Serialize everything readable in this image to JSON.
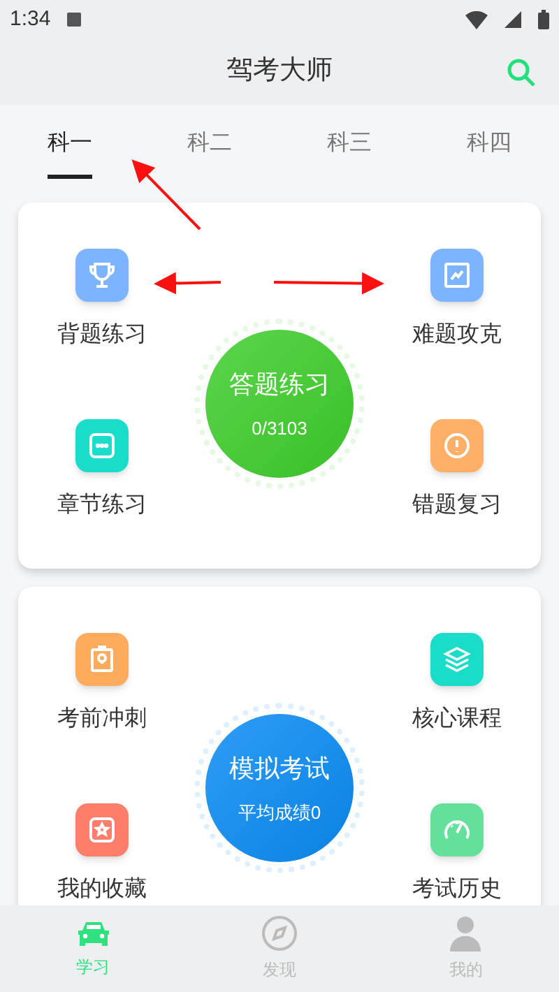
{
  "status_bar": {
    "time": "1:34"
  },
  "header": {
    "title": "驾考大师"
  },
  "tabs": [
    {
      "label": "科一",
      "selected": true
    },
    {
      "label": "科二",
      "selected": false
    },
    {
      "label": "科三",
      "selected": false
    },
    {
      "label": "科四",
      "selected": false
    }
  ],
  "sections": [
    {
      "center": {
        "title": "答题练习",
        "subtitle": "0/3103",
        "color": "#3fcf2c"
      },
      "items": [
        {
          "label": "背题练习",
          "color": "#7db4ff"
        },
        {
          "label": "难题攻克",
          "color": "#7db4ff"
        },
        {
          "label": "章节练习",
          "color": "#19dccb"
        },
        {
          "label": "错题复习",
          "color": "#ffb066"
        }
      ]
    },
    {
      "center": {
        "title": "模拟考试",
        "subtitle": "平均成绩0",
        "color": "#0a8cf5"
      },
      "items": [
        {
          "label": "考前冲刺",
          "color": "#ffab5e"
        },
        {
          "label": "核心课程",
          "color": "#19dcc9"
        },
        {
          "label": "我的收藏",
          "color": "#ff7d6b"
        },
        {
          "label": "考试历史",
          "color": "#63e09a"
        }
      ]
    }
  ],
  "bottom_nav": [
    {
      "label": "学习",
      "selected": true
    },
    {
      "label": "发现",
      "selected": false
    },
    {
      "label": "我的",
      "selected": false
    }
  ]
}
